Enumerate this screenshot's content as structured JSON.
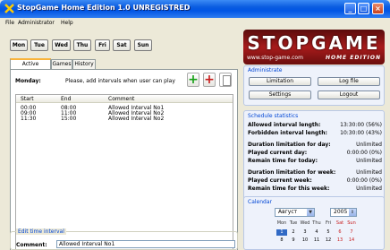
{
  "window": {
    "title": "StopGame Home Edition 1.0 UNREGISTRED",
    "controls": [
      "_",
      "□",
      "×"
    ]
  },
  "menu": [
    "File",
    "Administrator",
    "Help"
  ],
  "days": [
    "Mon",
    "Tue",
    "Wed",
    "Thu",
    "Fri",
    "Sat",
    "Sun"
  ],
  "tabs": [
    "Active schedule",
    "Games",
    "History"
  ],
  "schedule": {
    "day_label": "Monday:",
    "hint": "Please, add intervals when user can play",
    "columns": [
      "Start",
      "End",
      "Comment"
    ],
    "rows": [
      {
        "start": "00:00",
        "end": "08:00",
        "comment": "Allowed Interval No1"
      },
      {
        "start": "09:00",
        "end": "11:00",
        "comment": "Allowed Interval No2"
      },
      {
        "start": "11:30",
        "end": "15:00",
        "comment": "Allowed Interval No2"
      }
    ]
  },
  "edit": {
    "title": "Edit time interval",
    "comment_label": "Comment:",
    "comment_value": "Allowed Interval No1"
  },
  "logo": {
    "text": "STOPGAME",
    "url": "www.stop-game.com",
    "edition": "HOME EDITION"
  },
  "administrate": {
    "title": "Administrate",
    "buttons": [
      "Limitation",
      "Log file",
      "Settings",
      "Logout"
    ]
  },
  "stats": {
    "title": "Schedule statistics",
    "rows": [
      {
        "label": "Allowed interval length:",
        "value": "13:30:00 (56%)"
      },
      {
        "label": "Forbidden interval length:",
        "value": "10:30:00 (43%)"
      },
      {
        "label": "Duration limitation for day:",
        "value": "Unlimited"
      },
      {
        "label": "Played current day:",
        "value": "0:00:00 (0%)"
      },
      {
        "label": "Remain time for today:",
        "value": "Unlimited"
      },
      {
        "label": "Duration limitation for week:",
        "value": "Unlimited"
      },
      {
        "label": "Played current week:",
        "value": "0:00:00 (0%)"
      },
      {
        "label": "Remain time for this week:",
        "value": "Unlimited"
      }
    ]
  },
  "calendar": {
    "title": "Calendar",
    "month": "Август",
    "year": "2005",
    "weekdays": [
      "Mon",
      "Tue",
      "Wed",
      "Thu",
      "Fri",
      "Sat",
      "Sun"
    ],
    "week1": [
      "1",
      "2",
      "3",
      "4",
      "5",
      "6",
      "7"
    ],
    "week2": [
      "8",
      "9",
      "10",
      "11",
      "12",
      "13",
      "14"
    ]
  }
}
